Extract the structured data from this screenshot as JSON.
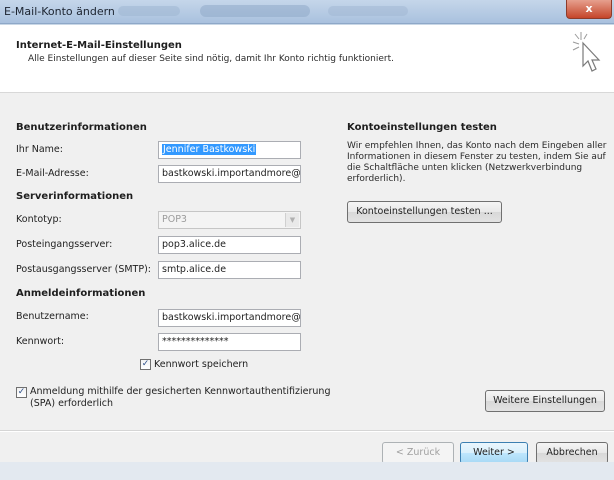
{
  "window": {
    "title": "E-Mail-Konto ändern",
    "close_label": "x"
  },
  "header": {
    "title": "Internet-E-Mail-Einstellungen",
    "subtitle": "Alle Einstellungen auf dieser Seite sind nötig, damit Ihr Konto richtig funktioniert.",
    "icon": "cursor-sparkle-icon"
  },
  "user_info": {
    "heading": "Benutzerinformationen",
    "name_label": "Ihr Name:",
    "name_value": "Jennifer Bastkowski",
    "email_label": "E-Mail-Adresse:",
    "email_value": "bastkowski.importandmore@a"
  },
  "server_info": {
    "heading": "Serverinformationen",
    "type_label": "Kontotyp:",
    "type_value": "POP3",
    "incoming_label": "Posteingangsserver:",
    "incoming_value": "pop3.alice.de",
    "outgoing_label": "Postausgangsserver (SMTP):",
    "outgoing_value": "smtp.alice.de"
  },
  "login_info": {
    "heading": "Anmeldeinformationen",
    "username_label": "Benutzername:",
    "username_value": "bastkowski.importandmore@a",
    "password_label": "Kennwort:",
    "password_value": "**************",
    "save_password_label": "Kennwort speichern",
    "save_password_checked": "✓",
    "spa_label_line1": "Anmeldung mithilfe der gesicherten Kennwortauthentifizierung",
    "spa_label_line2": "(SPA) erforderlich",
    "spa_checked": "✓"
  },
  "test": {
    "heading": "Kontoeinstellungen testen",
    "description": "Wir empfehlen Ihnen, das Konto nach dem Eingeben aller Informationen in diesem Fenster zu testen, indem Sie auf die Schaltfläche unten klicken (Netzwerkverbindung erforderlich).",
    "button_label": "Kontoeinstellungen testen ..."
  },
  "buttons": {
    "more_settings": "Weitere Einstellungen",
    "back": "< Zurück",
    "next": "Weiter >",
    "cancel": "Abbrechen"
  }
}
